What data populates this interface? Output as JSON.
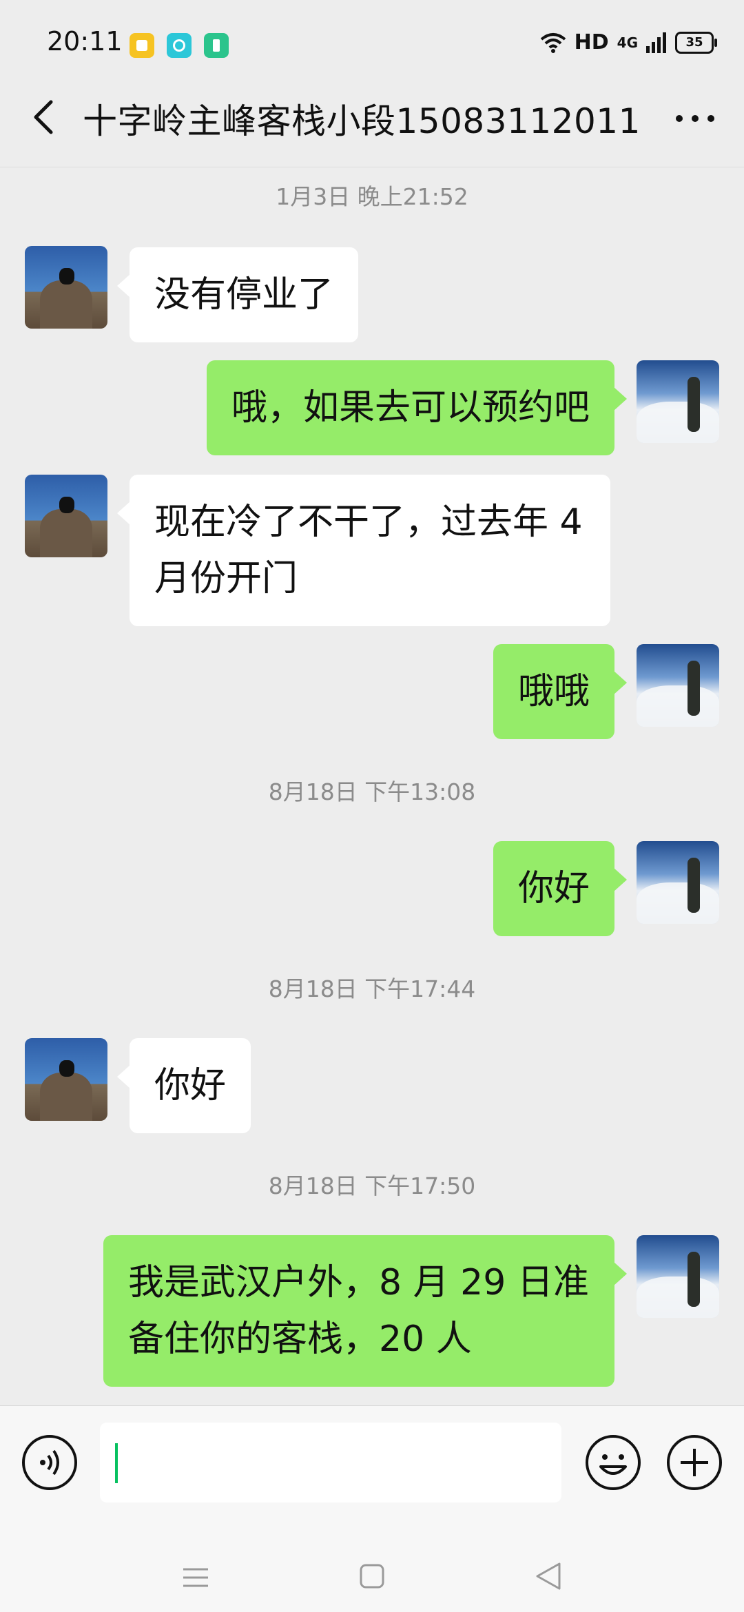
{
  "status_bar": {
    "time": "20:11",
    "network_label": "HD",
    "signal_label": "4G",
    "battery": "35",
    "app_icons": [
      "notes-app-icon",
      "camera-app-icon",
      "battery-saver-app-icon"
    ]
  },
  "nav": {
    "title": "十字岭主峰客栈小段15083112011",
    "back_icon": "chevron-left-icon",
    "more_icon": "more-dots-icon"
  },
  "messages": [
    {
      "type": "time",
      "text": "1月3日 晚上21:52"
    },
    {
      "type": "msg",
      "side": "left",
      "text": "没有停业了"
    },
    {
      "type": "msg",
      "side": "right",
      "text": "哦，如果去可以预约吧"
    },
    {
      "type": "msg",
      "side": "left",
      "text": "现在冷了不干了，过去年 4 月份开门"
    },
    {
      "type": "msg",
      "side": "right",
      "text": "哦哦"
    },
    {
      "type": "time",
      "text": "8月18日 下午13:08"
    },
    {
      "type": "msg",
      "side": "right",
      "text": "你好"
    },
    {
      "type": "time",
      "text": "8月18日 下午17:44"
    },
    {
      "type": "msg",
      "side": "left",
      "text": "你好"
    },
    {
      "type": "time",
      "text": "8月18日 下午17:50"
    },
    {
      "type": "msg",
      "side": "right",
      "text": "我是武汉户外，8 月 29 日准备住你的客栈，20 人"
    }
  ],
  "input_bar": {
    "voice_icon": "voice-icon",
    "input_value": "",
    "emoji_icon": "emoji-icon",
    "plus_icon": "plus-icon"
  },
  "colors": {
    "background": "#ededed",
    "bubble_sent": "#95ec69",
    "bubble_received": "#ffffff",
    "accent": "#07c160"
  }
}
